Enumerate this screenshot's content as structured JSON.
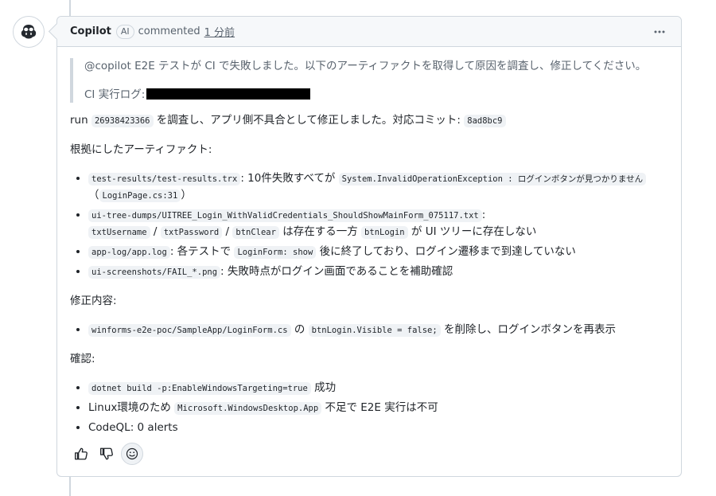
{
  "header": {
    "author": "Copilot",
    "badge": "AI",
    "action": "commented",
    "timestamp": "1 分前"
  },
  "quote": {
    "line1": "@copilot E2E テストが CI で失敗しました。以下のアーティファクトを取得して原因を調査し、修正してください。",
    "line2": "CI 実行ログ:"
  },
  "body": {
    "intro": {
      "prefix": "run ",
      "run_id": "26938423366",
      "middle": " を調査し、アプリ側不具合として修正しました。対応コミット: ",
      "commit": "8ad8bc9"
    },
    "evidence_heading": "根拠にしたアーティファクト:",
    "evidence": {
      "item1": {
        "code1": "test-results/test-results.trx",
        "text1": ": 10件失敗すべてが ",
        "code2": "System.InvalidOperationException : ログインボタンが見つかりません",
        "text2": "（",
        "code3": "LoginPage.cs:31",
        "text3": "）"
      },
      "item2": {
        "code1": "ui-tree-dumps/UITREE_Login_WithValidCredentials_ShouldShowMainForm_075117.txt",
        "text1": ":",
        "code2": "txtUsername",
        "sep1": " / ",
        "code3": "txtPassword",
        "sep2": " / ",
        "code4": "btnClear",
        "text2": " は存在する一方 ",
        "code5": "btnLogin",
        "text3": " が UI ツリーに存在しない"
      },
      "item3": {
        "code1": "app-log/app.log",
        "text1": ": 各テストで ",
        "code2": "LoginForm: show",
        "text2": " 後に終了しており、ログイン遷移まで到達していない"
      },
      "item4": {
        "code1": "ui-screenshots/FAIL_*.png",
        "text1": ": 失敗時点がログイン画面であることを補助確認"
      }
    },
    "fix_heading": "修正内容:",
    "fix": {
      "code1": "winforms-e2e-poc/SampleApp/LoginForm.cs",
      "text1": " の ",
      "code2": "btnLogin.Visible = false;",
      "text2": " を削除し、ログインボタンを再表示"
    },
    "verify_heading": "確認:",
    "verify": {
      "item1": {
        "code1": "dotnet build -p:EnableWindowsTargeting=true",
        "text1": " 成功"
      },
      "item2": {
        "text0": "Linux環境のため ",
        "code1": "Microsoft.WindowsDesktop.App",
        "text1": " 不足で E2E 実行は不可"
      },
      "item3": {
        "text0": "CodeQL: 0 alerts"
      }
    }
  },
  "icons": {
    "avatar": "copilot-icon",
    "menu": "kebab-horizontal-icon",
    "thumbs_up": "thumbs-up-icon",
    "thumbs_down": "thumbs-down-icon",
    "reaction": "smiley-icon"
  },
  "colors": {
    "border": "#d0d7de",
    "header_bg": "#f6f8fa",
    "muted": "#59636e",
    "code_bg": "#eff2f5"
  }
}
